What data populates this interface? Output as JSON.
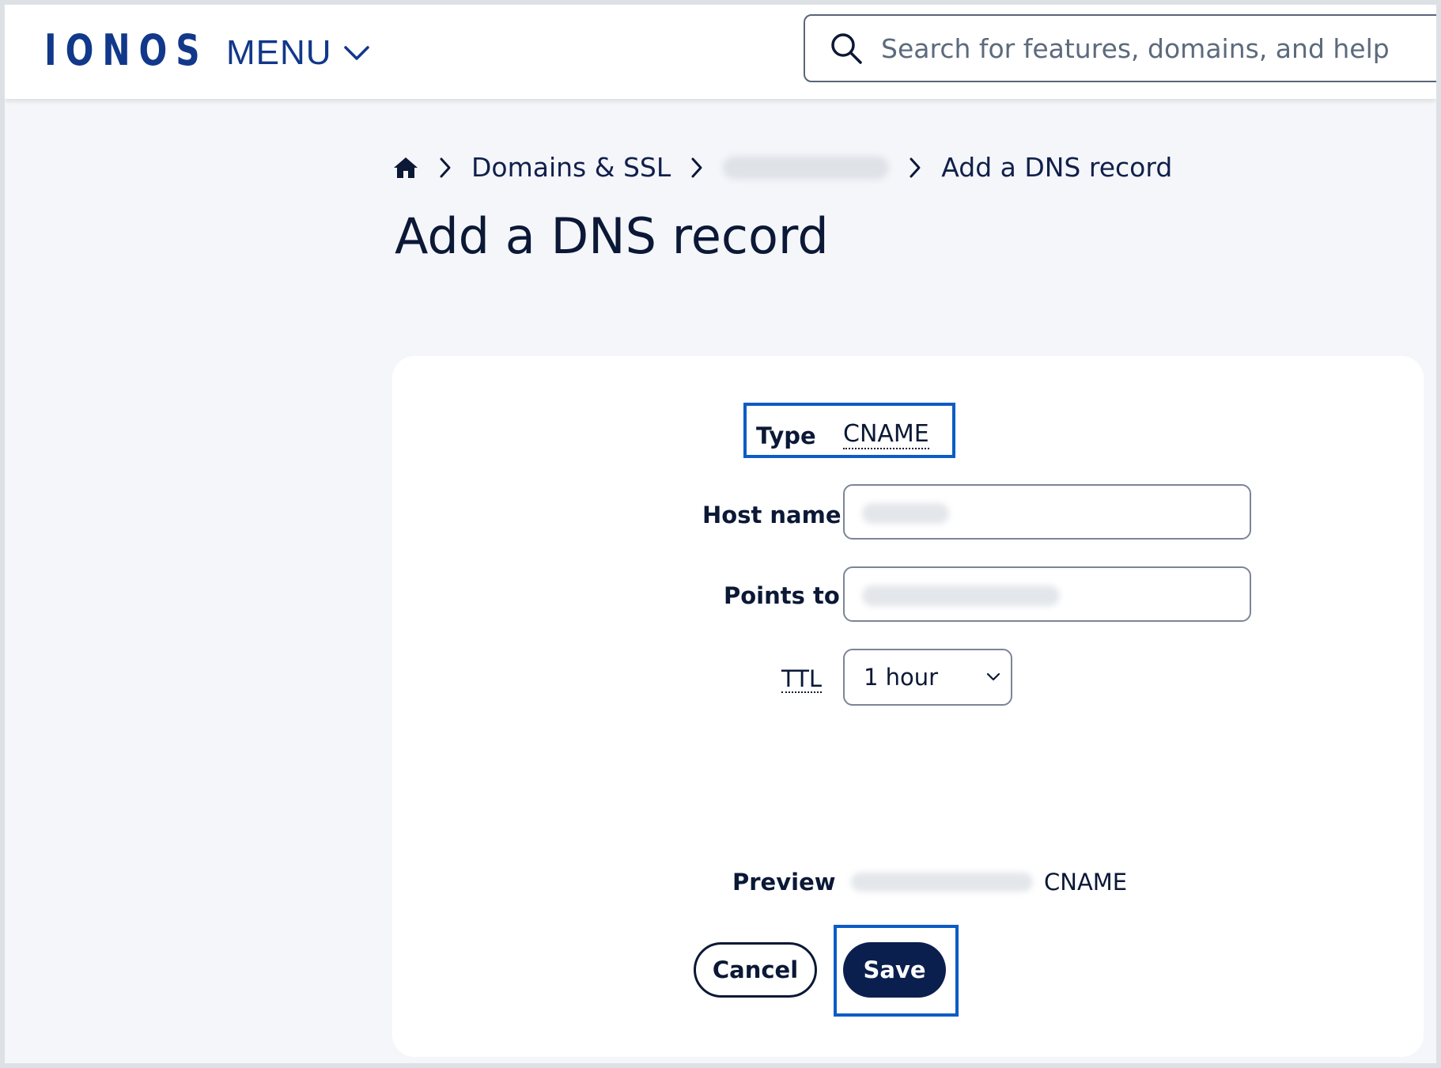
{
  "header": {
    "logo_text": "IONOS",
    "menu_label": "MENU",
    "search_placeholder": "Search for features, domains, and help"
  },
  "breadcrumb": {
    "home_icon": "home-icon",
    "items": [
      "Domains & SSL",
      "Add a DNS record"
    ]
  },
  "page": {
    "title": "Add a DNS record"
  },
  "form": {
    "type_label": "Type",
    "type_value": "CNAME",
    "host_label": "Host name",
    "points_label": "Points to",
    "ttl_label": "TTL",
    "ttl_value": "1 hour",
    "preview_label": "Preview",
    "preview_type": "CNAME",
    "cancel_label": "Cancel",
    "save_label": "Save"
  },
  "colors": {
    "brand": "#11388a",
    "highlight": "#0b5cc4",
    "primary_button": "#0b1f4f",
    "page_bg": "#f4f6fa"
  }
}
